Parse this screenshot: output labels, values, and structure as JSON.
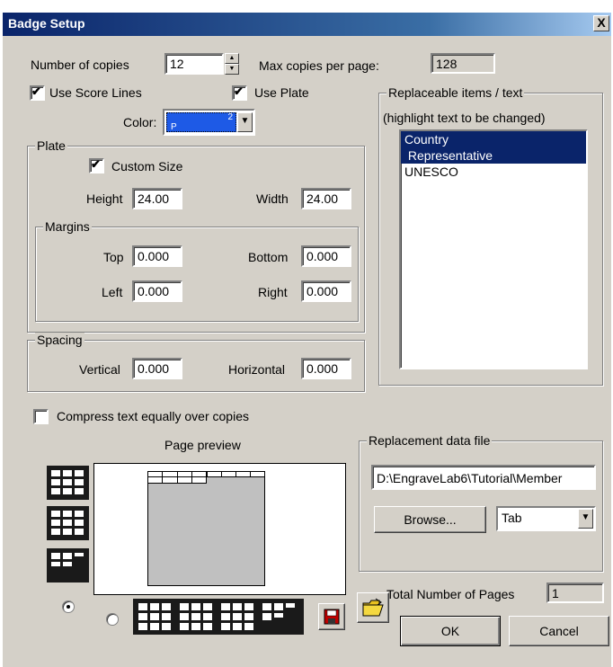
{
  "window": {
    "title": "Badge Setup",
    "close_glyph": "X"
  },
  "copies": {
    "label": "Number of copies",
    "value": "12",
    "max_label": "Max copies per page:",
    "max_value": "128"
  },
  "score_lines": {
    "label": "Use Score Lines",
    "checked": true
  },
  "use_plate": {
    "label": "Use Plate",
    "checked": true
  },
  "color": {
    "label": "Color:",
    "swatch_top": "2",
    "swatch_bottom": "P",
    "swatch_color": "#1e5ae6"
  },
  "plate": {
    "group_label": "Plate",
    "custom_size": {
      "label": "Custom Size",
      "checked": true
    },
    "height": {
      "label": "Height",
      "value": "24.00"
    },
    "width": {
      "label": "Width",
      "value": "24.00"
    },
    "margins": {
      "group_label": "Margins",
      "top": {
        "label": "Top",
        "value": "0.000"
      },
      "bottom": {
        "label": "Bottom",
        "value": "0.000"
      },
      "left": {
        "label": "Left",
        "value": "0.000"
      },
      "right": {
        "label": "Right",
        "value": "0.000"
      }
    }
  },
  "spacing": {
    "group_label": "Spacing",
    "vertical": {
      "label": "Vertical",
      "value": "0.000"
    },
    "horizontal": {
      "label": "Horizontal",
      "value": "0.000"
    }
  },
  "compress": {
    "label": "Compress text equally over copies",
    "checked": false
  },
  "replaceable": {
    "group_label": "Replaceable items / text",
    "hint": "(highlight text to be changed)",
    "items": [
      {
        "text": "Country",
        "selected": true
      },
      {
        "text": " Representative",
        "selected": true
      },
      {
        "text": "UNESCO",
        "selected": false
      }
    ]
  },
  "preview": {
    "label": "Page preview"
  },
  "replacement_file": {
    "group_label": "Replacement data file",
    "path": "D:\\EngraveLab6\\Tutorial\\Member",
    "browse_label": "Browse...",
    "delimiter": "Tab"
  },
  "total_pages": {
    "label": "Total Number of Pages",
    "value": "1"
  },
  "buttons": {
    "ok": "OK",
    "cancel": "Cancel"
  },
  "colors": {
    "title_start": "#0a246a",
    "title_end": "#a6caf0",
    "dialog_bg": "#d4d0c8",
    "selection": "#0a246a"
  }
}
